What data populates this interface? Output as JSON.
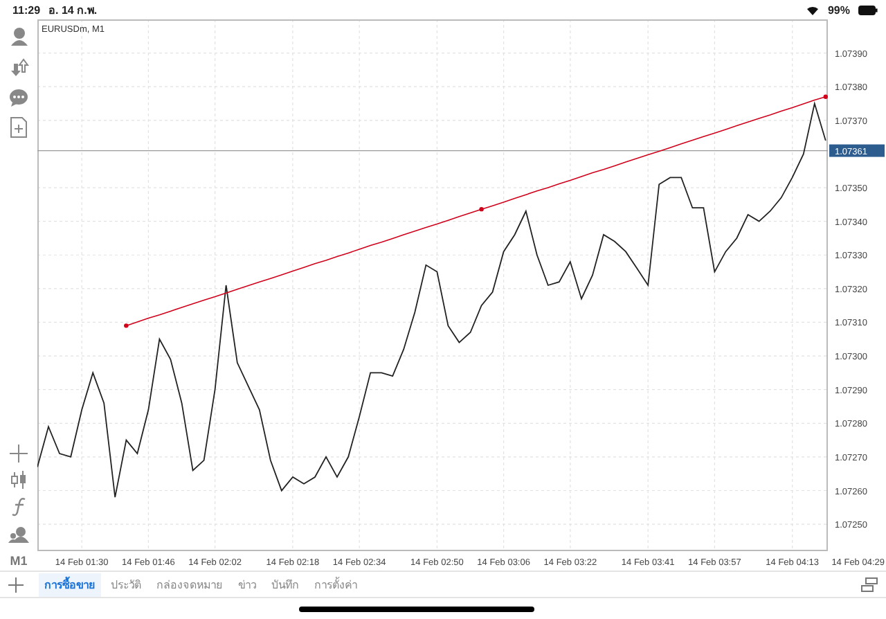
{
  "status_bar": {
    "time": "11:29",
    "date": "อ. 14 ก.พ.",
    "battery": "99%"
  },
  "chart": {
    "title": "EURUSDm, M1",
    "chart_data": {
      "type": "line",
      "grid": true,
      "ylim": [
        1.07242,
        1.074
      ],
      "categories": [
        null,
        null,
        null,
        null,
        "14 Feb 01:30",
        null,
        null,
        null,
        null,
        null,
        "14 Feb 01:46",
        null,
        null,
        null,
        null,
        null,
        "14 Feb 02:02",
        null,
        null,
        null,
        null,
        null,
        null,
        "14 Feb 02:18",
        null,
        null,
        null,
        null,
        null,
        "14 Feb 02:34",
        null,
        null,
        null,
        null,
        null,
        null,
        "14 Feb 02:50",
        null,
        null,
        null,
        null,
        null,
        "14 Feb 03:06",
        null,
        null,
        null,
        null,
        null,
        "14 Feb 03:22",
        null,
        null,
        null,
        null,
        null,
        null,
        "14 Feb 03:41",
        null,
        null,
        null,
        null,
        null,
        "14 Feb 03:57",
        null,
        null,
        null,
        null,
        null,
        null,
        "14 Feb 04:13",
        null,
        null,
        null
      ],
      "yticks": [
        {
          "value": 1.0739,
          "label": "1.07390"
        },
        {
          "value": 1.0738,
          "label": "1.07380"
        },
        {
          "value": 1.0737,
          "label": "1.07370"
        },
        {
          "value": 1.0735,
          "label": "1.07350"
        },
        {
          "value": 1.0734,
          "label": "1.07340"
        },
        {
          "value": 1.0733,
          "label": "1.07330"
        },
        {
          "value": 1.0732,
          "label": "1.07320"
        },
        {
          "value": 1.0731,
          "label": "1.07310"
        },
        {
          "value": 1.073,
          "label": "1.07300"
        },
        {
          "value": 1.0729,
          "label": "1.07290"
        },
        {
          "value": 1.0728,
          "label": "1.07280"
        },
        {
          "value": 1.0727,
          "label": "1.07270"
        },
        {
          "value": 1.0726,
          "label": "1.07260"
        },
        {
          "value": 1.0725,
          "label": "1.07250"
        }
      ],
      "series": [
        {
          "color": "#999999",
          "values": [
            1.07361,
            1.07361,
            1.07361,
            1.07361,
            1.07361,
            1.07361,
            1.07361,
            1.07361,
            1.07361,
            1.07361,
            1.07361,
            1.07361,
            1.07361,
            1.07361,
            1.07361,
            1.07361,
            1.07361,
            1.07361,
            1.07361,
            1.07361,
            1.07361,
            1.07361,
            1.07361,
            1.07361,
            1.07361,
            1.07361,
            1.07361,
            1.07361,
            1.07361,
            1.07361,
            1.07361,
            1.07361,
            1.07361,
            1.07361,
            1.07361,
            1.07361,
            1.07361,
            1.07361,
            1.07361,
            1.07361,
            1.07361,
            1.07361,
            1.07361,
            1.07361,
            1.07361,
            1.07361,
            1.07361,
            1.07361,
            1.07361,
            1.07361,
            1.07361,
            1.07361,
            1.07361,
            1.07361,
            1.07361,
            1.07361,
            1.07361,
            1.07361,
            1.07361,
            1.07361,
            1.07361,
            1.07361,
            1.07361,
            1.07361,
            1.07361,
            1.07361,
            1.07361,
            1.07361,
            1.07361,
            1.07361,
            1.07361,
            1.07361
          ]
        },
        {
          "color": "#222222",
          "values": [
            1.07267,
            1.07279,
            1.07271,
            1.0727,
            1.07284,
            1.07295,
            1.07286,
            1.07258,
            1.07275,
            1.07271,
            1.07284,
            1.07305,
            1.07299,
            1.07286,
            1.07266,
            1.07269,
            1.0729,
            1.07321,
            1.07298,
            1.07291,
            1.07284,
            1.07269,
            1.0726,
            1.07264,
            1.07262,
            1.07264,
            1.0727,
            1.07264,
            1.0727,
            1.07282,
            1.07295,
            1.07295,
            1.07294,
            1.07302,
            1.07313,
            1.07327,
            1.07325,
            1.07309,
            1.07304,
            1.07307,
            1.07315,
            1.07319,
            1.07331,
            1.07336,
            1.07343,
            1.0733,
            1.07321,
            1.07322,
            1.07328,
            1.07317,
            1.07324,
            1.07336,
            1.07334,
            1.07331,
            1.07326,
            1.07321,
            1.07351,
            1.07353,
            1.07353,
            1.07344,
            1.07344,
            1.07325,
            1.07331,
            1.07335,
            1.07342,
            1.0734,
            1.07343,
            1.07347,
            1.07353,
            1.0736,
            1.07375,
            1.07364
          ]
        },
        {
          "color": "#d0021b",
          "values": [
            null,
            null,
            null,
            null,
            null,
            null,
            null,
            null,
            1.07309,
            1.073101,
            1.073112,
            1.073122,
            1.073133,
            1.073144,
            1.073155,
            1.073166,
            1.073176,
            1.073187,
            1.073198,
            1.073209,
            1.07322,
            1.07323,
            1.073241,
            1.073252,
            1.073263,
            1.073274,
            1.073284,
            1.073295,
            1.073306,
            1.073317,
            1.073328,
            1.073338,
            1.073349,
            1.07336,
            1.073371,
            1.073382,
            1.073392,
            1.073403,
            1.073414,
            1.073425,
            1.073436,
            1.073446,
            1.073457,
            1.073468,
            1.073479,
            1.07349,
            1.0735,
            1.073511,
            1.073522,
            1.073533,
            1.073544,
            1.073554,
            1.073565,
            1.073576,
            1.073587,
            1.073598,
            1.073608,
            1.073619,
            1.07363,
            1.073641,
            1.073652,
            1.073662,
            1.073673,
            1.073684,
            1.073695,
            1.073706,
            1.073716,
            1.073727,
            1.073738,
            1.073749,
            1.07376,
            1.07377
          ]
        }
      ]
    },
    "axis_end_label": "14 Feb 04:29",
    "price_tag": "1.07361"
  },
  "toolbar": {
    "timeframe": "M1"
  },
  "tabs": [
    {
      "label": "การซื้อขาย",
      "selected": true
    },
    {
      "label": "ประวัติ",
      "selected": false
    },
    {
      "label": "กล่องจดหมาย",
      "selected": false
    },
    {
      "label": "ข่าว",
      "selected": false
    },
    {
      "label": "บันทึก",
      "selected": false
    },
    {
      "label": "การตั้งค่า",
      "selected": false
    }
  ]
}
